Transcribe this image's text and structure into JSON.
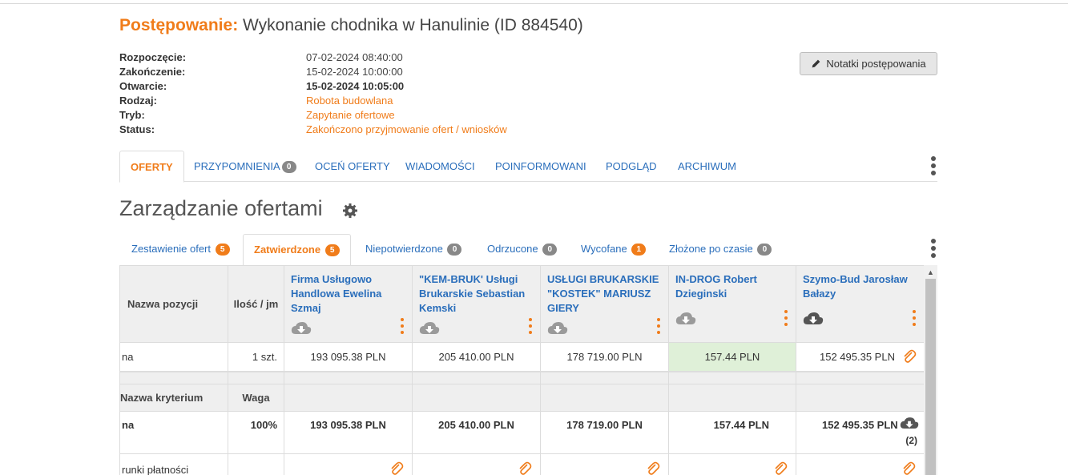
{
  "header": {
    "label": "Postępowanie:",
    "title": "Wykonanie chodnika w Hanulinie (ID 884540)"
  },
  "meta": [
    {
      "key": "Rozpoczęcie:",
      "value": "07-02-2024 08:40:00"
    },
    {
      "key": "Zakończenie:",
      "value": "15-02-2024 10:00:00"
    },
    {
      "key": "Otwarcie:",
      "value": "15-02-2024 10:05:00"
    },
    {
      "key": "Rodzaj:",
      "value": "Robota budowlana"
    },
    {
      "key": "Tryb:",
      "value": "Zapytanie ofertowe"
    },
    {
      "key": "Status:",
      "value": "Zakończono przyjmowanie ofert / wniosków"
    }
  ],
  "notes_button": "Notatki postępowania",
  "main_tabs": [
    {
      "label": "OFERTY"
    },
    {
      "label": "PRZYPOMNIENIA",
      "badge": "0"
    },
    {
      "label": "OCEŃ OFERTY"
    },
    {
      "label": "WIADOMOŚCI"
    },
    {
      "label": "POINFORMOWANI"
    },
    {
      "label": "PODGLĄD"
    },
    {
      "label": "ARCHIWUM"
    }
  ],
  "section_title": "Zarządzanie ofertami",
  "sub_tabs": [
    {
      "label": "Zestawienie ofert",
      "badge": "5"
    },
    {
      "label": "Zatwierdzone",
      "badge": "5"
    },
    {
      "label": "Niepotwierdzone",
      "badge": "0"
    },
    {
      "label": "Odrzucone",
      "badge": "0"
    },
    {
      "label": "Wycofane",
      "badge": "1"
    },
    {
      "label": "Złożone po czasie",
      "badge": "0"
    }
  ],
  "table": {
    "col_position": "Nazwa pozycji",
    "col_qty": "Ilość / jm",
    "vendors": [
      "Firma Usługowo Handlowa Ewelina Szmaj",
      "\"KEM-BRUK' Usługi Brukarskie Sebastian Kemski",
      "USŁUGI BRUKARSKIE \"KOSTEK\" MARIUSZ GIERY",
      "IN-DROG Robert Dzieginski",
      "Szymo-Bud Jarosław Bałazy"
    ],
    "row1": {
      "name": "na",
      "qty": "1 szt.",
      "prices": [
        "193 095.38 PLN",
        "205 410.00 PLN",
        "178 719.00 PLN",
        "157.44 PLN",
        "152 495.35 PLN"
      ]
    },
    "col_criterion": "Nazwa kryterium",
    "col_weight": "Waga",
    "row2": {
      "name": "na",
      "weight": "100%",
      "prices": [
        "193 095.38 PLN",
        "205 410.00 PLN",
        "178 719.00 PLN",
        "157.44 PLN",
        "152 495.35 PLN"
      ],
      "download_count": "(2)"
    },
    "row3": {
      "name": "runki płatności"
    }
  },
  "colors": {
    "accent": "#f07c1a",
    "link": "#2a6ebb",
    "highlight": "#dff0d8"
  }
}
